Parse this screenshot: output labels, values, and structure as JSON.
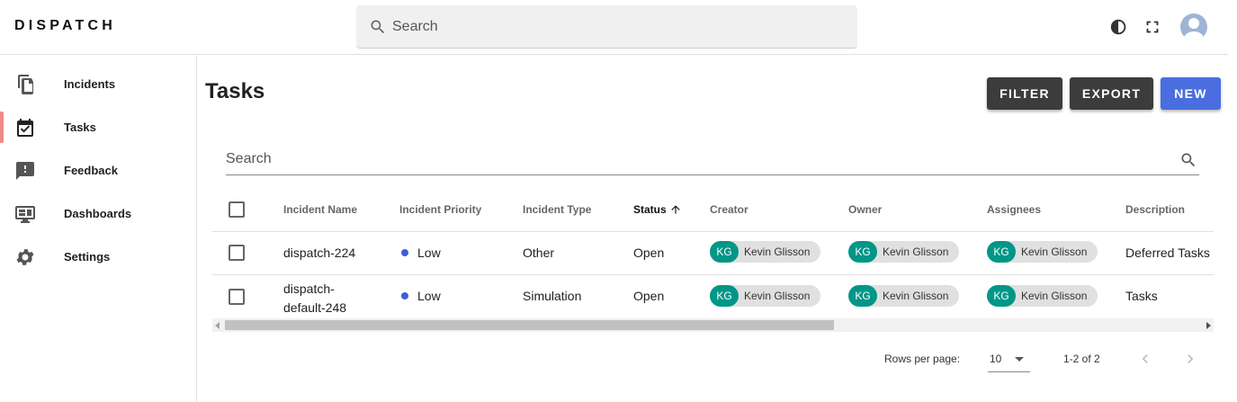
{
  "app": {
    "brand": "DISPATCH",
    "search_placeholder": "Search",
    "icons": {
      "search": "search-icon",
      "theme": "moon-icon",
      "fullscreen": "fullscreen-icon",
      "avatar": "avatar"
    }
  },
  "sidebar": {
    "items": [
      {
        "label": "Incidents",
        "icon": "file-copy-icon",
        "active": false
      },
      {
        "label": "Tasks",
        "icon": "calendar-check-icon",
        "active": true
      },
      {
        "label": "Feedback",
        "icon": "feedback-icon",
        "active": false
      },
      {
        "label": "Dashboards",
        "icon": "monitor-dashboard-icon",
        "active": false
      },
      {
        "label": "Settings",
        "icon": "gear-icon",
        "active": false
      }
    ]
  },
  "main": {
    "title": "Tasks",
    "buttons": {
      "filter": "FILTER",
      "export": "EXPORT",
      "new": "NEW"
    },
    "table_search_placeholder": "Search",
    "columns": [
      "Incident Name",
      "Incident Priority",
      "Incident Type",
      "Status",
      "Creator",
      "Owner",
      "Assignees",
      "Description"
    ],
    "sorted_column": "Status",
    "rows": [
      {
        "incident_name": "dispatch-224",
        "priority": "Low",
        "type": "Other",
        "status": "Open",
        "creator": {
          "initials": "KG",
          "name": "Kevin Glisson"
        },
        "owner": {
          "initials": "KG",
          "name": "Kevin Glisson"
        },
        "assignee": {
          "initials": "KG",
          "name": "Kevin Glisson"
        },
        "description": "Deferred Tasks"
      },
      {
        "incident_name_line1": "dispatch-",
        "incident_name_line2": "default-248",
        "priority": "Low",
        "type": "Simulation",
        "status": "Open",
        "creator": {
          "initials": "KG",
          "name": "Kevin Glisson"
        },
        "owner": {
          "initials": "KG",
          "name": "Kevin Glisson"
        },
        "assignee": {
          "initials": "KG",
          "name": "Kevin Glisson"
        },
        "description": "Tasks"
      }
    ],
    "footer": {
      "rows_per_page_label": "Rows per page:",
      "rows_per_page_value": "10",
      "range": "1-2 of 2"
    }
  },
  "colors": {
    "primary": "#4a6ee0",
    "dark_button": "#3c3c3c",
    "chip_avatar": "#009688",
    "priority_low": "#3f5fd8",
    "active_indicator": "#ef8a8a"
  }
}
